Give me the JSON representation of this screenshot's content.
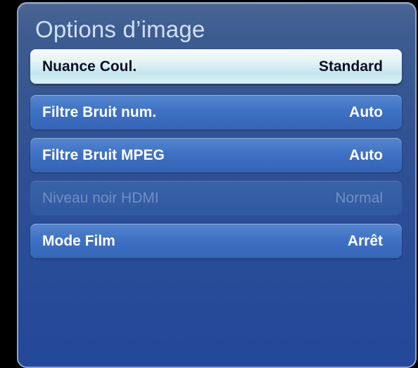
{
  "menu": {
    "title": "Options d’image",
    "items": [
      {
        "label": "Nuance Coul.",
        "value": "Standard",
        "state": "selected"
      },
      {
        "label": "Filtre Bruit num.",
        "value": "Auto",
        "state": "enabled"
      },
      {
        "label": "Filtre Bruit MPEG",
        "value": "Auto",
        "state": "enabled"
      },
      {
        "label": "Niveau noir HDMI",
        "value": "Normal",
        "state": "disabled"
      },
      {
        "label": "Mode Film",
        "value": "Arrêt",
        "state": "enabled"
      }
    ]
  },
  "colors": {
    "panel_background": "#2e5094",
    "item_background": "#3f72c4",
    "selected_item_background": "#d9f0f5",
    "disabled_text": "#6f8fc4",
    "title_text": "#cfe0f3"
  }
}
